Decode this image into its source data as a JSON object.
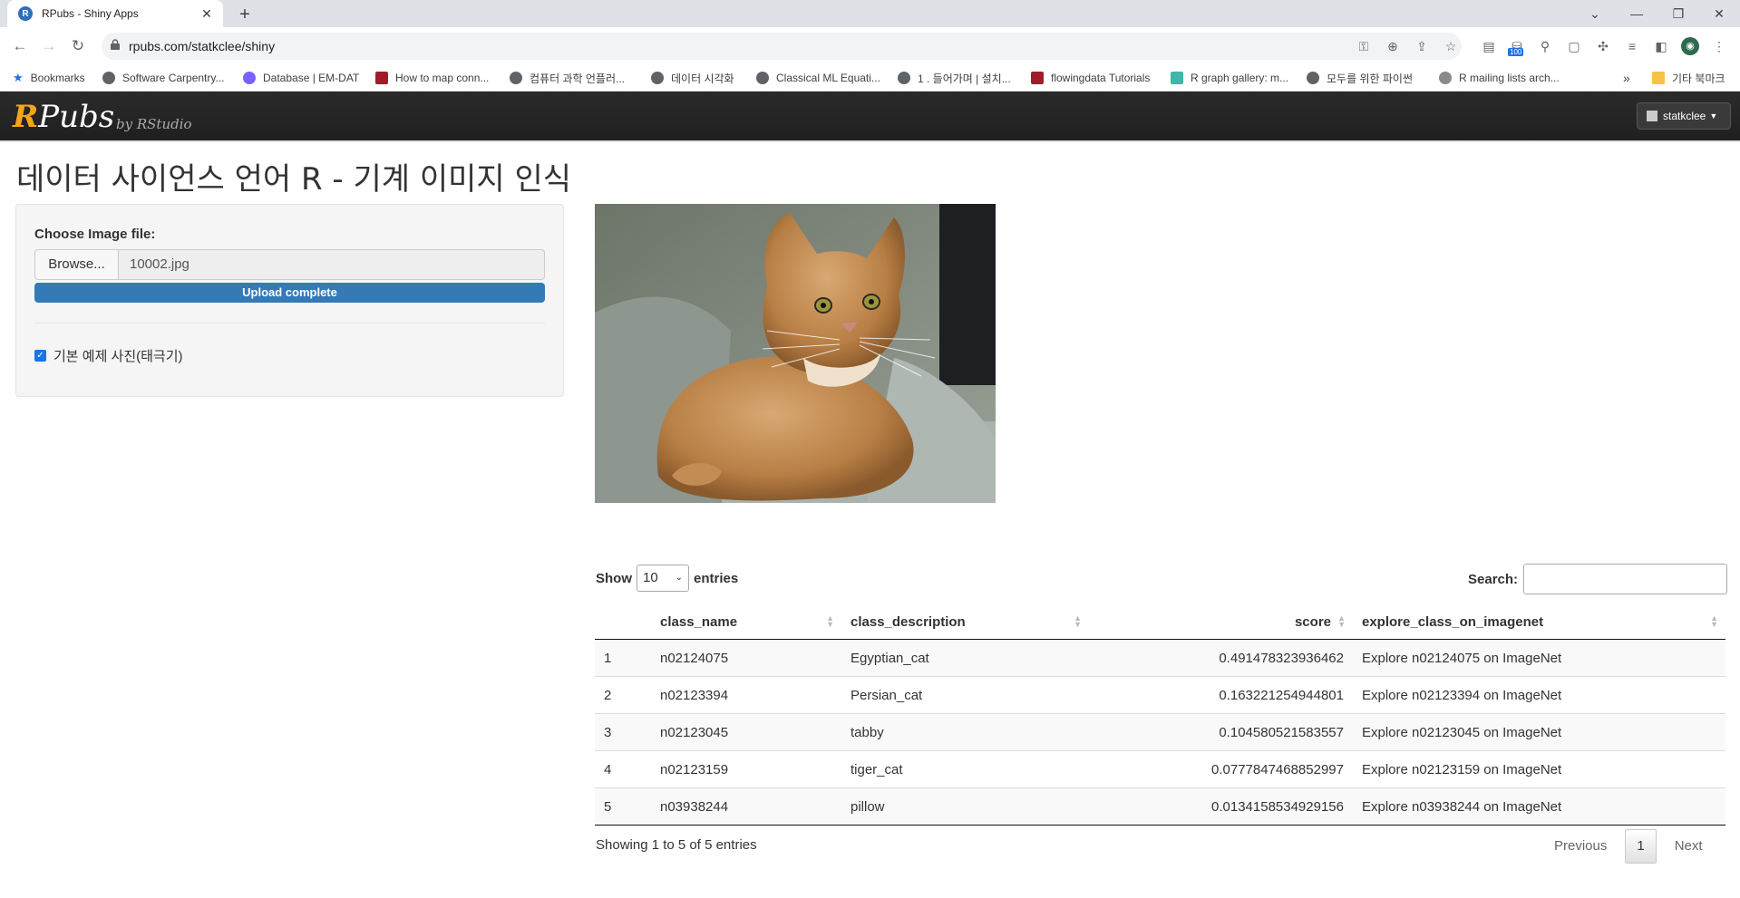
{
  "browser": {
    "tab_title": "RPubs - Shiny Apps",
    "tab_favicon": "R",
    "url": "rpubs.com/statkclee/shiny",
    "extension_badge": "100",
    "bookmarks": [
      "Bookmarks",
      "Software Carpentry...",
      "Database | EM-DAT",
      "How to map conn...",
      "컴퓨터 과학 언플러...",
      "데이터 시각화",
      "Classical ML Equati...",
      "1 . 들어가며 | 설치...",
      "flowingdata Tutorials",
      "R graph gallery: m...",
      "모두를 위한 파이썬",
      "R mailing lists arch..."
    ],
    "bookmarks_overflow": "»",
    "other_bookmarks": "기타 북마크"
  },
  "navbar": {
    "brand_r": "R",
    "brand_rest": "Pubs",
    "byline": "by RStudio",
    "user": "statkclee"
  },
  "page": {
    "title": "데이터 사이언스 언어 R - 기계 이미지 인식"
  },
  "sidebar": {
    "file_label": "Choose Image file:",
    "browse_label": "Browse...",
    "file_name": "10002.jpg",
    "upload_status": "Upload complete",
    "upload_progress": 1.0,
    "checkbox_label": "기본 예제 사진(태극기)",
    "checkbox_checked": true
  },
  "table": {
    "length_label_pre": "Show",
    "length_value": "10",
    "length_label_post": "entries",
    "search_label": "Search:",
    "columns": [
      "",
      "class_name",
      "class_description",
      "score",
      "explore_class_on_imagenet"
    ],
    "rows": [
      [
        "1",
        "n02124075",
        "Egyptian_cat",
        "0.491478323936462",
        "Explore n02124075 on ImageNet"
      ],
      [
        "2",
        "n02123394",
        "Persian_cat",
        "0.163221254944801",
        "Explore n02123394 on ImageNet"
      ],
      [
        "3",
        "n02123045",
        "tabby",
        "0.104580521583557",
        "Explore n02123045 on ImageNet"
      ],
      [
        "4",
        "n02123159",
        "tiger_cat",
        "0.0777847468852997",
        "Explore n02123159 on ImageNet"
      ],
      [
        "5",
        "n03938244",
        "pillow",
        "0.0134158534929156",
        "Explore n03938244 on ImageNet"
      ]
    ],
    "info": "Showing 1 to 5 of 5 entries",
    "pager": {
      "previous": "Previous",
      "current": "1",
      "next": "Next"
    }
  },
  "colors": {
    "accent": "#337ab7",
    "brand_orange": "#f4a51c",
    "navbar": "#222222"
  }
}
